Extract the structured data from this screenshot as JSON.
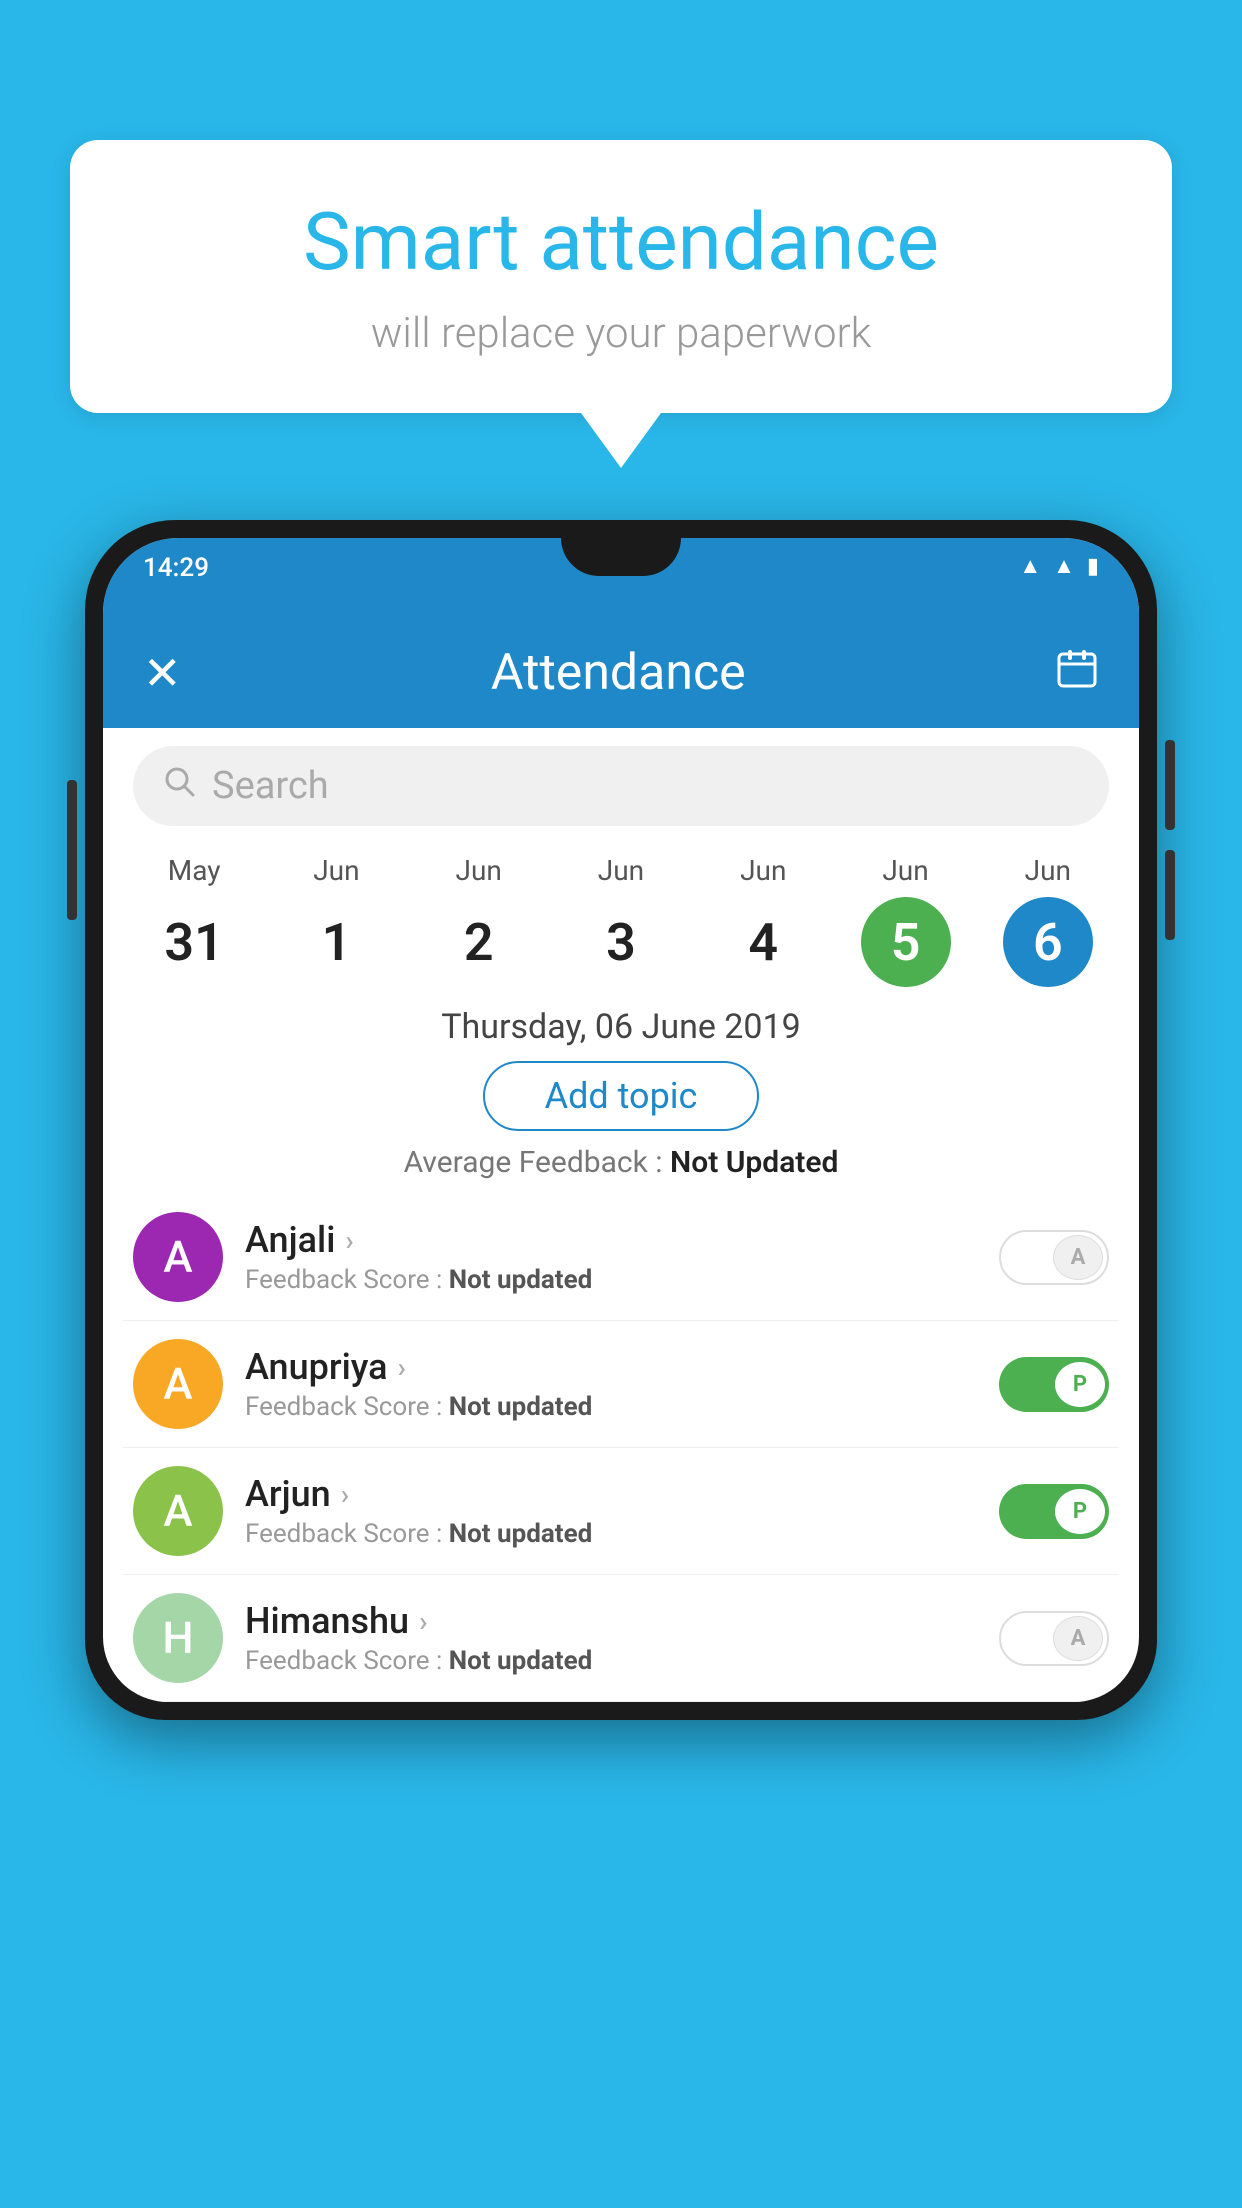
{
  "background_color": "#29b6e8",
  "speech_bubble": {
    "title": "Smart attendance",
    "subtitle": "will replace your paperwork"
  },
  "status_bar": {
    "time": "14:29",
    "wifi_icon": "▲",
    "signal_icon": "▲",
    "battery_icon": "▮"
  },
  "app_bar": {
    "title": "Attendance",
    "close_label": "✕",
    "calendar_label": "📅"
  },
  "search": {
    "placeholder": "Search"
  },
  "calendar": {
    "days": [
      {
        "month": "May",
        "date": "31",
        "style": "normal"
      },
      {
        "month": "Jun",
        "date": "1",
        "style": "normal"
      },
      {
        "month": "Jun",
        "date": "2",
        "style": "normal"
      },
      {
        "month": "Jun",
        "date": "3",
        "style": "normal"
      },
      {
        "month": "Jun",
        "date": "4",
        "style": "normal"
      },
      {
        "month": "Jun",
        "date": "5",
        "style": "today"
      },
      {
        "month": "Jun",
        "date": "6",
        "style": "selected"
      }
    ]
  },
  "selected_date": "Thursday, 06 June 2019",
  "add_topic_label": "Add topic",
  "average_feedback": {
    "label": "Average Feedback : ",
    "value": "Not Updated"
  },
  "students": [
    {
      "name": "Anjali",
      "avatar_letter": "A",
      "avatar_color": "#9c27b0",
      "feedback_label": "Feedback Score : ",
      "feedback_value": "Not updated",
      "attendance": "absent"
    },
    {
      "name": "Anupriya",
      "avatar_letter": "A",
      "avatar_color": "#f9a825",
      "feedback_label": "Feedback Score : ",
      "feedback_value": "Not updated",
      "attendance": "present"
    },
    {
      "name": "Arjun",
      "avatar_letter": "A",
      "avatar_color": "#8bc34a",
      "feedback_label": "Feedback Score : ",
      "feedback_value": "Not updated",
      "attendance": "present"
    },
    {
      "name": "Himanshu",
      "avatar_letter": "H",
      "avatar_color": "#a5d6a7",
      "feedback_label": "Feedback Score : ",
      "feedback_value": "Not updated",
      "attendance": "absent"
    }
  ]
}
